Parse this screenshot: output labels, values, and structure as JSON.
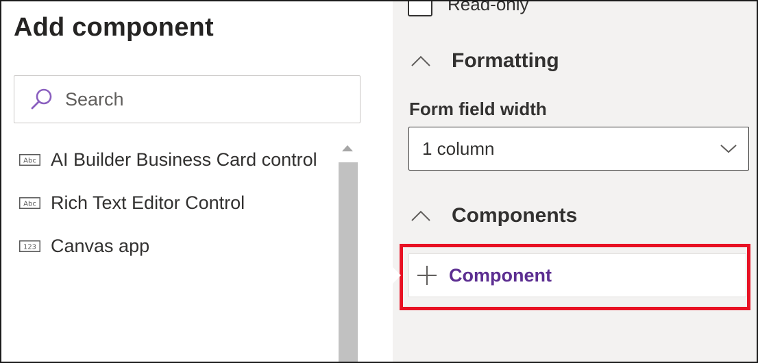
{
  "add_component_panel": {
    "title": "Add component",
    "search": {
      "placeholder": "Search",
      "value": "",
      "icon": "search-icon"
    },
    "items": [
      {
        "label": "AI Builder Business Card control",
        "icon": "text-type-icon",
        "icon_text": "Abc"
      },
      {
        "label": "Rich Text Editor Control",
        "icon": "text-type-icon",
        "icon_text": "Abc"
      },
      {
        "label": "Canvas app",
        "icon": "number-type-icon",
        "icon_text": "123"
      }
    ]
  },
  "properties_panel": {
    "read_only": {
      "label": "Read-only",
      "checked": false
    },
    "formatting": {
      "title": "Formatting",
      "expanded": true,
      "form_field_width": {
        "label": "Form field width",
        "selected": "1 column"
      }
    },
    "components": {
      "title": "Components",
      "expanded": true,
      "add_button_label": "Component"
    }
  },
  "colors": {
    "accent_purple": "#5c2e91",
    "search_icon": "#8a5fbf",
    "highlight_red": "#e81123",
    "right_pane_bg": "#f3f2f1"
  }
}
